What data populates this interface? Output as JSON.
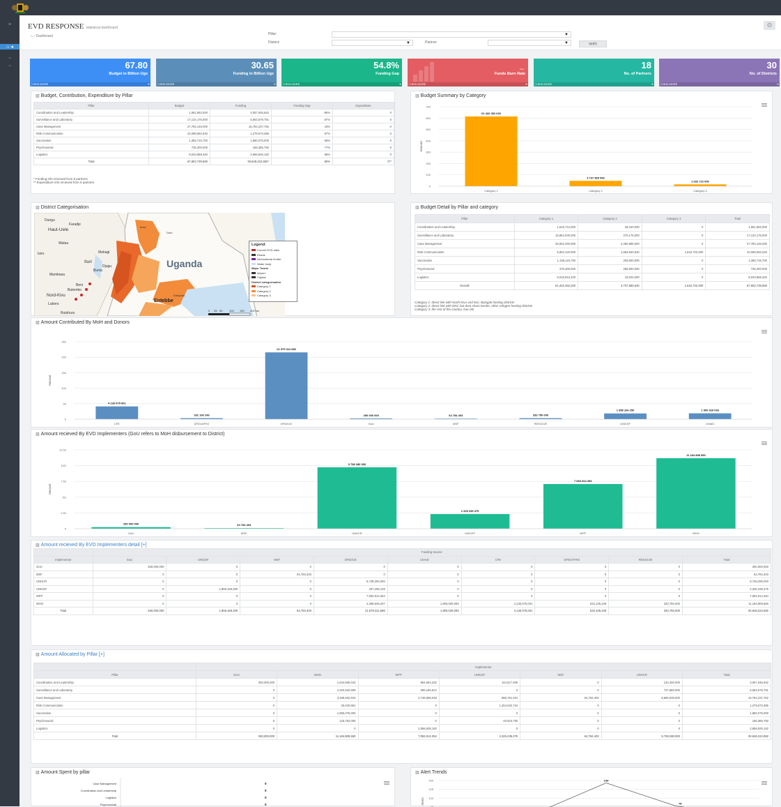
{
  "app": {
    "title": "EVD RESPONSE",
    "subtitle": "statistical dashboard"
  },
  "nav": {
    "home_icon": "home-icon",
    "breadcrumb_home": "⌂",
    "breadcrumb_sep": "›",
    "breadcrumb": "Dashboard"
  },
  "filters": {
    "pillar_label": "Pillar:",
    "district_label": "District:",
    "partner_label": "Partner:",
    "apply": "apply"
  },
  "kpis": [
    {
      "value": "67.80",
      "label": "Budget in Billion Ugx",
      "color": "#3d8ff5",
      "more": "VIEW MORE"
    },
    {
      "value": "30.65",
      "label": "Funding in Billion Ugx",
      "color": "#5b8fb9",
      "more": "VIEW MORE"
    },
    {
      "value": "54.8%",
      "label": "Funding Gap",
      "color": "#1bb68a",
      "more": "VIEW MORE"
    },
    {
      "value": "",
      "label": "Funds Burn Rate",
      "color": "#e35d62",
      "more": "VIEW MORE",
      "extra": "Fine"
    },
    {
      "value": "18",
      "label": "No. of Partners",
      "color": "#25b7a1",
      "more": "VIEW MORE"
    },
    {
      "value": "30",
      "label": "No. of Districts",
      "color": "#8b75b6",
      "more": "VIEW MORE"
    }
  ],
  "panels": {
    "budget_pillar": "Budget, Contribution, Expenditure by Pillar",
    "summary": "Budget Summary by Category",
    "district": "District Categorisation",
    "detail": "Budget Detail by Pillar and category",
    "contributed": "Amount Contributed By MoH and Donors",
    "received": "Amount recieved By EVD Implementers (GoU refers to MoH disbursement to District)",
    "received_detail": "Amount recieved By EVD Implementers detail [+]",
    "allocated": "Amount Allocated by Pillar [+]",
    "spent": "Amount Spent by pillar",
    "alerts": "Alert Trends"
  },
  "budget_table": {
    "headers": [
      "Pillar",
      "Budget",
      "Funding",
      "Funding Gap",
      "Expenditure"
    ],
    "rows": [
      [
        "Coordination and Leadership",
        "1,651,952,000",
        "3,057,545,842",
        "-85%",
        "0"
      ],
      [
        "Surveillance and Laboratory",
        "17,134,175,000",
        "5,653,578,781",
        "67%",
        "0"
      ],
      [
        "Case Management",
        "27,783,146,000",
        "15,754,237,762",
        "43%",
        "0"
      ],
      [
        "Risk Communication",
        "10,098,682,540",
        "1,279,573,385",
        "87%",
        "0"
      ],
      [
        "Vaccination",
        "1,365,715,700",
        "1,880,075,000",
        "-38%",
        "0"
      ],
      [
        "Psychosocial",
        "735,200,000",
        "166,385,750",
        "77%",
        "0"
      ],
      [
        "Logistics",
        "9,033,868,320",
        "2,856,826,162",
        "68%",
        "0"
      ]
    ],
    "total": [
      "Total",
      "67,802,739,560",
      "30,648,222,682*",
      "55%",
      "0**"
    ],
    "notes": [
      "* Funding info recieved from 8 partners",
      "** Expenditure info recieved from 8 partners"
    ]
  },
  "detail_table": {
    "headers": [
      "Pillar",
      "Category 1",
      "Category 2",
      "Category 3",
      "Total"
    ],
    "rows": [
      [
        "Coordination and Leadership",
        "1,615,712,000",
        "36,240,000",
        "0",
        "1,651,952,000"
      ],
      [
        "Surveillance and Laboratory",
        "16,864,000,000",
        "270,175,000",
        "0",
        "17,134,175,000"
      ],
      [
        "Case Management",
        "25,502,260,000",
        "2,280,886,000",
        "0",
        "27,783,146,000"
      ],
      [
        "Risk Communication",
        "6,802,120,000",
        "1,663,840,540",
        "1,632,722,000",
        "10,098,682,540"
      ],
      [
        "Vaccination",
        "1,156,115,700",
        "209,600,000",
        "0",
        "1,365,715,700"
      ],
      [
        "Psychosocial",
        "476,400,000",
        "258,800,000",
        "0",
        "735,200,000"
      ],
      [
        "Logistics",
        "9,015,844,320",
        "18,024,000",
        "0",
        "9,033,868,320"
      ]
    ],
    "total": [
      "Overall",
      "61,432,452,020",
      "4,737,565,540",
      "1,632,722,000",
      "67,802,739,560"
    ],
    "notes": [
      "Category 1: direct link with North Kivu and Ituri, Bulagali hosting districts",
      "Category 2: direct link with DRC but dont share border, other refugee hosting districts",
      "Category 3: the rest of the country, low risk"
    ]
  },
  "map": {
    "labels": [
      "Dungu",
      "Faradje",
      "Haut-Uele",
      "Watsa",
      "Mahagi",
      "Ituri",
      "Djugu",
      "Bunia",
      "Isiro",
      "Mambasa",
      "Beni",
      "Butembo",
      "Nord-Kivu",
      "Lubero",
      "Rutshuru",
      "Uganda",
      "Entebbe",
      "Arua",
      "Gulu",
      "Kampala"
    ],
    "legend_title": "Legend",
    "legend": [
      "Current EVD sites",
      "Roads",
      "International border",
      "Water body",
      "Major Towns",
      "Airport",
      "Capital",
      "District categorisation",
      "Category 1",
      "Category 2",
      "Category 3"
    ],
    "scale": [
      "0",
      "25",
      "50",
      "100",
      "150",
      "200 km"
    ]
  },
  "chart_data": [
    {
      "type": "bar",
      "title": "Budget Summary by Category",
      "ylabel": "Amount",
      "categories": [
        "Category 1",
        "Category 2",
        "Category 3"
      ],
      "values": [
        61432452020,
        4737565540,
        1632722000
      ],
      "labels": [
        "61 432 452 020",
        "4 737 565 540",
        "1 632 722 000"
      ],
      "yticks": [
        "700",
        "600",
        "500",
        "400",
        "300",
        "200",
        "100",
        "0"
      ],
      "ylim": [
        0,
        700
      ],
      "scale": 100000000,
      "color": "#ffa500"
    },
    {
      "type": "bar",
      "title": "Amount Contributed By MoH and Donors",
      "ylabel": "Amount",
      "categories": [
        "CFE",
        "DFID/AFRO",
        "DFID/UG",
        "GoU",
        "MSF",
        "RESOLVE",
        "UNICEF",
        "USAID"
      ],
      "values": [
        4130075001,
        332106249,
        21579311686,
        250000000,
        64784403,
        333750000,
        1858166250,
        1900029093
      ],
      "labels": [
        "4 130 075 001",
        "332 106 249",
        "21 579 311 686",
        "250 000 000",
        "64 784 403",
        "333 750 000",
        "1 858 166 250",
        "1 900 029 093"
      ],
      "yticks": [
        "250",
        "200",
        "150",
        "100",
        "50",
        "0"
      ],
      "ylim": [
        0,
        250
      ],
      "scale": 100000000,
      "color": "#5b8fc2"
    },
    {
      "type": "bar",
      "title": "Amount recieved By EVD Implementers",
      "ylabel": "Amount",
      "categories": [
        "GoU",
        "MSF",
        "UNHCR",
        "UNICEF",
        "WFP",
        "WHO"
      ],
      "values": [
        250000000,
        64784403,
        9738280000,
        2325435375,
        7084914354,
        11184808550
      ],
      "labels": [
        "250 000 000",
        "64 784 403",
        "9 738 280 000",
        "2 325 435 375",
        "7 084 914 354",
        "11 184 808 550"
      ],
      "yticks": [
        "12.50",
        "10G",
        "7.50",
        "5G",
        "2.50",
        "0"
      ],
      "ylim": [
        0,
        12.5
      ],
      "scale": 1000000000,
      "color": "#1fbc94"
    },
    {
      "type": "bar",
      "title": "Amount Spent by pillar",
      "orientation": "horizontal",
      "categories": [
        "Case Management",
        "Coordination and Leadership",
        "Logistics",
        "Psychosocial"
      ],
      "values": [
        0,
        0,
        0,
        0
      ],
      "labels": [
        "0",
        "0",
        "0",
        "0"
      ]
    },
    {
      "type": "line",
      "title": "Alert Trends",
      "ylabel": "Alerts",
      "yticks": [
        "150",
        "125",
        "100",
        "75"
      ],
      "ylim": [
        75,
        150
      ],
      "labels": [
        "143",
        "78"
      ],
      "points": [
        [
          0,
          null
        ],
        [
          1,
          143
        ],
        [
          2,
          78
        ]
      ]
    }
  ],
  "received_table": {
    "group": "Funding Source",
    "headers": [
      "Implementor",
      "GoU",
      "UNICEF",
      "MSF",
      "DFID/UG",
      "USAID",
      "CFE",
      "DFID/AFRO",
      "RESOLVE",
      "Total"
    ],
    "rows": [
      [
        "GoU",
        "250,000,000",
        "0",
        "0",
        "0",
        "0",
        "0",
        "0",
        "0",
        "250,000,000"
      ],
      [
        "MSF",
        "0",
        "0",
        "64,784,403",
        "0",
        "0",
        "0",
        "0",
        "0",
        "64,784,403"
      ],
      [
        "UNHCR",
        "0",
        "0",
        "0",
        "9,738,280,000",
        "0",
        "0",
        "0",
        "0",
        "9,738,280,000"
      ],
      [
        "UNICEF",
        "0",
        "1,858,166,250",
        "0",
        "467,269,125",
        "0",
        "0",
        "0",
        "0",
        "2,325,435,375"
      ],
      [
        "WFP",
        "0",
        "0",
        "0",
        "7,084,914,354",
        "0",
        "0",
        "0",
        "0",
        "7,084,914,354"
      ],
      [
        "WHO",
        "0",
        "0",
        "0",
        "4,288,848,207",
        "1,900,029,093",
        "4,130,075,001",
        "532,106,249",
        "333,750,000",
        "11,184,808,550"
      ]
    ],
    "total": [
      "Total",
      "250,000,000",
      "1,858,166,250",
      "64,784,403",
      "21,579,311,686",
      "1,900,029,093",
      "4,130,075,001",
      "532,106,249",
      "333,750,000",
      "30,648,222,682"
    ]
  },
  "allocated_table": {
    "group": "Implementor",
    "headers": [
      "Pillar",
      "GoU",
      "WHO",
      "WFP",
      "UNICEF",
      "MSF",
      "UNHCR",
      "Total"
    ],
    "rows": [
      [
        "Coordination and Leadership",
        "250,000,000",
        "1,644,565,010",
        "884,063,332",
        "144,517,500",
        "0",
        "134,400,000",
        "3,057,545,842"
      ],
      [
        "Surveillance and Laboratory",
        "0",
        "4,320,532,909",
        "595,165,812",
        "0",
        "0",
        "737,880,000",
        "5,653,578,781"
      ],
      [
        "Case Management",
        "0",
        "3,188,832,910",
        "2,748,859,048",
        "885,761,401",
        "64,784,403",
        "8,866,000,000",
        "15,754,237,762"
      ],
      [
        "Risk Communication",
        "0",
        "25,040,661",
        "0",
        "1,254,532,724",
        "0",
        "0",
        "1,279,573,385"
      ],
      [
        "Vaccination",
        "0",
        "1,880,075,000",
        "0",
        "0",
        "0",
        "0",
        "1,880,075,000"
      ],
      [
        "Psychosocial",
        "0",
        "125,762,000",
        "0",
        "40,623,750",
        "0",
        "0",
        "166,385,750"
      ],
      [
        "Logistics",
        "0",
        "0",
        "2,856,826,162",
        "0",
        "0",
        "0",
        "2,856,826,162"
      ]
    ],
    "total": [
      "Total",
      "250,000,000",
      "11,184,808,550",
      "7,084,914,354",
      "2,325,435,375",
      "64,784,403",
      "9,738,280,000",
      "30,648,222,682"
    ]
  }
}
